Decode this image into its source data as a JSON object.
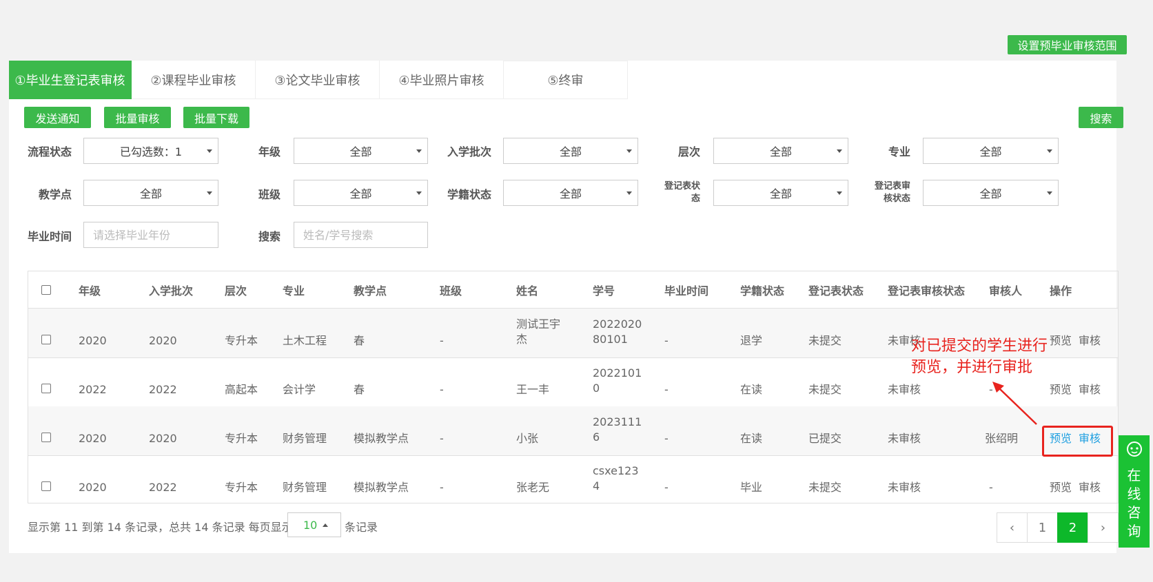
{
  "top_button": "设置预毕业审核范围",
  "tabs": [
    "①毕业生登记表审核",
    "②课程毕业审核",
    "③论文毕业审核",
    "④毕业照片审核",
    "⑤终审"
  ],
  "actions": {
    "notify": "发送通知",
    "batch_review": "批量审核",
    "batch_download": "批量下载",
    "search": "搜索"
  },
  "filters": {
    "process_status": {
      "label": "流程状态",
      "value": "已勾选数：1"
    },
    "grade": {
      "label": "年级",
      "value": "全部"
    },
    "batch": {
      "label": "入学批次",
      "value": "全部"
    },
    "level": {
      "label": "层次",
      "value": "全部"
    },
    "major": {
      "label": "专业",
      "value": "全部"
    },
    "teaching_point": {
      "label": "教学点",
      "value": "全部"
    },
    "class": {
      "label": "班级",
      "value": "全部"
    },
    "enroll_status": {
      "label": "学籍状态",
      "value": "全部"
    },
    "form_status": {
      "label1": "登记表状",
      "label2": "态",
      "value": "全部"
    },
    "form_review_status": {
      "label1": "登记表审",
      "label2": "核状态",
      "value": "全部"
    },
    "grad_time": {
      "label": "毕业时间",
      "placeholder": "请选择毕业年份"
    },
    "keyword": {
      "label": "搜索",
      "placeholder": "姓名/学号搜索"
    }
  },
  "table": {
    "headers": [
      "年级",
      "入学批次",
      "层次",
      "专业",
      "教学点",
      "班级",
      "姓名",
      "学号",
      "毕业时间",
      "学籍状态",
      "登记表状态",
      "登记表审核状态",
      "审核人",
      "操作"
    ],
    "rows": [
      {
        "grade": "2020",
        "batch": "2020",
        "level": "专升本",
        "major": "土木工程",
        "point": "春",
        "class": "-",
        "name1": "测试王宇",
        "name2": "杰",
        "id1": "2022020",
        "id2": "80101",
        "gtime": "-",
        "status": "退学",
        "form": "未提交",
        "review": "未审核",
        "reviewer": "-",
        "preview": "预览",
        "audit": "审核"
      },
      {
        "grade": "2022",
        "batch": "2022",
        "level": "高起本",
        "major": "会计学",
        "point": "春",
        "class": "-",
        "name1": "王一丰",
        "name2": "",
        "id1": "2022101",
        "id2": "0",
        "gtime": "-",
        "status": "在读",
        "form": "未提交",
        "review": "未审核",
        "reviewer": "-",
        "preview": "预览",
        "audit": "审核"
      },
      {
        "grade": "2020",
        "batch": "2020",
        "level": "专升本",
        "major": "财务管理",
        "point": "模拟教学点",
        "class": "-",
        "name1": "小张",
        "name2": "",
        "id1": "2023111",
        "id2": "6",
        "gtime": "-",
        "status": "在读",
        "form": "已提交",
        "review": "未审核",
        "reviewer": "张绍明",
        "preview": "预览",
        "audit": "审核"
      },
      {
        "grade": "2020",
        "batch": "2022",
        "level": "专升本",
        "major": "财务管理",
        "point": "模拟教学点",
        "class": "-",
        "name1": "张老无",
        "name2": "",
        "id1": "csxe123",
        "id2": "4",
        "gtime": "-",
        "status": "毕业",
        "form": "未提交",
        "review": "未审核",
        "reviewer": "-",
        "preview": "预览",
        "audit": "审核"
      }
    ]
  },
  "footer": {
    "summary": "显示第 11 到第 14 条记录，总共 14 条记录 每页显示",
    "page_size": "10",
    "suffix": "条记录"
  },
  "pager": {
    "prev": "‹",
    "pages": [
      "1",
      "2"
    ],
    "current": "2",
    "next": "›"
  },
  "annotation": {
    "line1": "对已提交的学生进行",
    "line2": "预览，并进行审批"
  },
  "consult": {
    "chars": [
      "在",
      "线",
      "咨",
      "询"
    ]
  },
  "colors": {
    "green": "#3cb94b",
    "link_blue": "#1e9fe0",
    "annotation_red": "#e8231e"
  }
}
